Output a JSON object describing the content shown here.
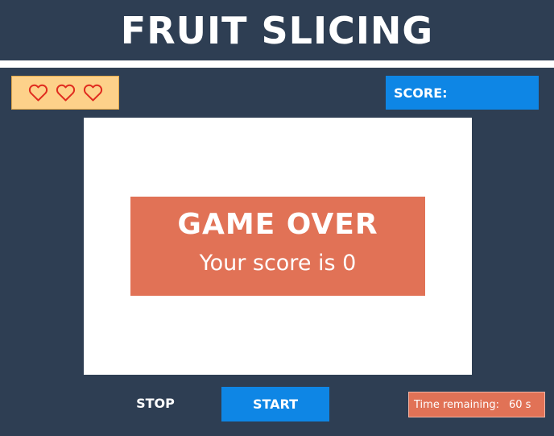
{
  "header": {
    "title": "FRUIT SLICING"
  },
  "lives": {
    "count": 3,
    "icon": "heart-outline-icon",
    "color": "#e02c1f"
  },
  "score": {
    "label": "SCORE:",
    "value": ""
  },
  "game_over": {
    "title": "GAME OVER",
    "message": "Your score is 0"
  },
  "controls": {
    "stop_label": "STOP",
    "start_label": "START"
  },
  "timer": {
    "label": "Time remaining:",
    "value": "60 s"
  },
  "colors": {
    "background": "#2e3e53",
    "accent_blue": "#0e86e5",
    "accent_orange": "#e17256",
    "lives_box": "#fdd18a"
  }
}
